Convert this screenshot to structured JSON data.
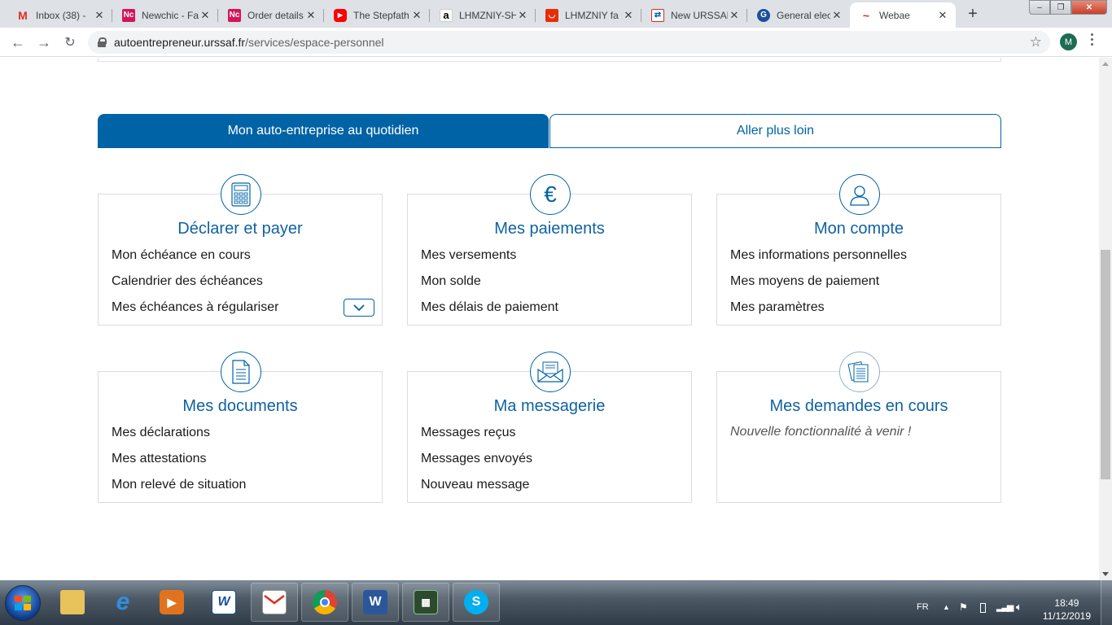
{
  "browser": {
    "tabs": [
      {
        "title": "Inbox (38) -",
        "icon": "gmail-icon",
        "color": "#d93025",
        "glyph": "M"
      },
      {
        "title": "Newchic - Fa",
        "icon": "newchic-icon",
        "color": "#d4145a",
        "glyph": "Nc"
      },
      {
        "title": "Order details",
        "icon": "newchic-icon",
        "color": "#d4145a",
        "glyph": "Nc"
      },
      {
        "title": "The Stepfath",
        "icon": "youtube-icon",
        "color": "#ff0000",
        "glyph": "▶"
      },
      {
        "title": "LHMZNIY-SH",
        "icon": "amazon-icon",
        "color": "#000000",
        "glyph": "a"
      },
      {
        "title": "LHMZNIY fa",
        "icon": "aliexpress-icon",
        "color": "#e62e04",
        "glyph": "◡"
      },
      {
        "title": "New URSSAF",
        "icon": "urssaf-icon",
        "color": "#0063a6",
        "glyph": "⇄"
      },
      {
        "title": "General elec",
        "icon": "ge-icon",
        "color": "#1b4f9c",
        "glyph": "G"
      },
      {
        "title": "Webae",
        "icon": "webae-icon",
        "color": "#e2231a",
        "glyph": "~"
      }
    ],
    "url_host": "autoentrepreneur.urssaf.fr",
    "url_path": "/services/espace-personnel",
    "profile_initial": "M"
  },
  "main_tabs": {
    "active": "Mon auto-entreprise au quotidien",
    "inactive": "Aller plus loin"
  },
  "cards": [
    {
      "title": "Déclarer et payer",
      "icon": "calculator-icon",
      "links": [
        "Mon échéance en cours",
        "Calendrier des échéances",
        "Mes échéances à régulariser"
      ]
    },
    {
      "title": "Mes paiements",
      "icon": "euro-icon",
      "links": [
        "Mes versements",
        "Mon solde",
        "Mes délais de paiement"
      ]
    },
    {
      "title": "Mon compte",
      "icon": "user-icon",
      "links": [
        "Mes informations personnelles",
        "Mes moyens de paiement",
        "Mes paramètres"
      ]
    },
    {
      "title": "Mes documents",
      "icon": "document-icon",
      "links": [
        "Mes déclarations",
        "Mes attestations",
        "Mon relevé de situation"
      ]
    },
    {
      "title": "Ma messagerie",
      "icon": "envelope-icon",
      "links": [
        "Messages reçus",
        "Messages envoyés",
        "Nouveau message"
      ]
    },
    {
      "title": "Mes demandes en cours",
      "icon": "papers-icon",
      "note": "Nouvelle fonctionnalité à venir !"
    }
  ],
  "taskbar": {
    "language": "FR",
    "time": "18:49",
    "date": "11/12/2019"
  },
  "colors": {
    "brand_blue": "#0063a6",
    "title_blue": "#0f62a2"
  }
}
